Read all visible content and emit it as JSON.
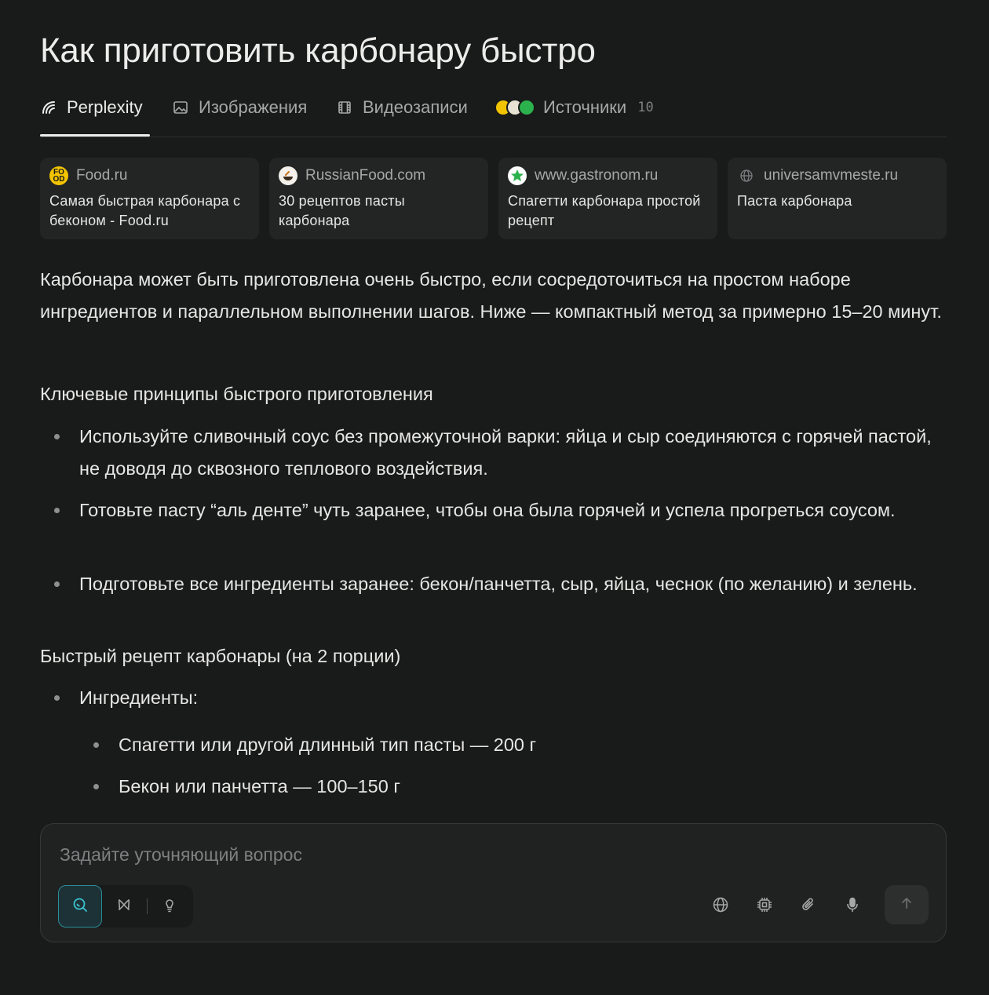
{
  "page": {
    "title": "Как приготовить карбонару быстро"
  },
  "tabs": [
    {
      "label": "Perplexity",
      "icon": "perplexity-logo-icon",
      "active": true
    },
    {
      "label": "Изображения",
      "icon": "image-icon"
    },
    {
      "label": "Видеозаписи",
      "icon": "film-icon"
    },
    {
      "label": "Источники",
      "icon": "source-favicons",
      "count": "10"
    }
  ],
  "sources": [
    {
      "site": "Food.ru",
      "title": "Самая быстрая карбонара с беконом - Food.ru",
      "favicon_color": "#f2c400",
      "favicon_text": "FO OD"
    },
    {
      "site": "RussianFood.com",
      "title": "30 рецептов пасты карбонара",
      "favicon_color": "#f4f1ea"
    },
    {
      "site": "www.gastronom.ru",
      "title": "Спагетти карбонара простой рецепт",
      "favicon_color": "#2bb24c"
    },
    {
      "site": "universamvmeste.ru",
      "title": "Паста карбонара",
      "favicon_color": "#2b2d2d"
    }
  ],
  "answer": {
    "intro": "Карбонара может быть приготовлена очень быстро, если сосредоточиться на простом наборе ингредиентов и параллельном выполнении шагов. Ниже — компактный метод за примерно 15–20 минут.",
    "section1_heading": "Ключевые принципы быстрого приготовления",
    "section1_items": [
      "Используйте сливочный соус без промежуточной варки: яйца и сыр соединяются с горячей пастой, не доводя до сквозного теплового воздействия.",
      "Готовьте пасту “аль денте” чуть заранее, чтобы она была горячей и успела прогреться соусом.",
      "Подготовьте все ингредиенты заранее: бекон/панчетта, сыр, яйца, чеснок (по желанию) и зелень."
    ],
    "section2_heading": "Быстрый рецепт карбонары (на 2 порции)",
    "ingredients_label": "Ингредиенты:",
    "ingredients": [
      "Спагетти или другой длинный тип пасты — 200 г",
      "Бекон или панчетта — 100–150 г"
    ]
  },
  "composer": {
    "placeholder": "Задайте уточняющий вопрос",
    "modes": [
      "search-icon",
      "research-icon",
      "lightbulb-icon"
    ],
    "tools": [
      "globe-icon",
      "chip-icon",
      "paperclip-icon",
      "microphone-icon"
    ],
    "send_icon": "arrow-up-icon"
  },
  "colors": {
    "background": "#191a1a",
    "card": "#232525",
    "accent": "#2a8d99"
  }
}
